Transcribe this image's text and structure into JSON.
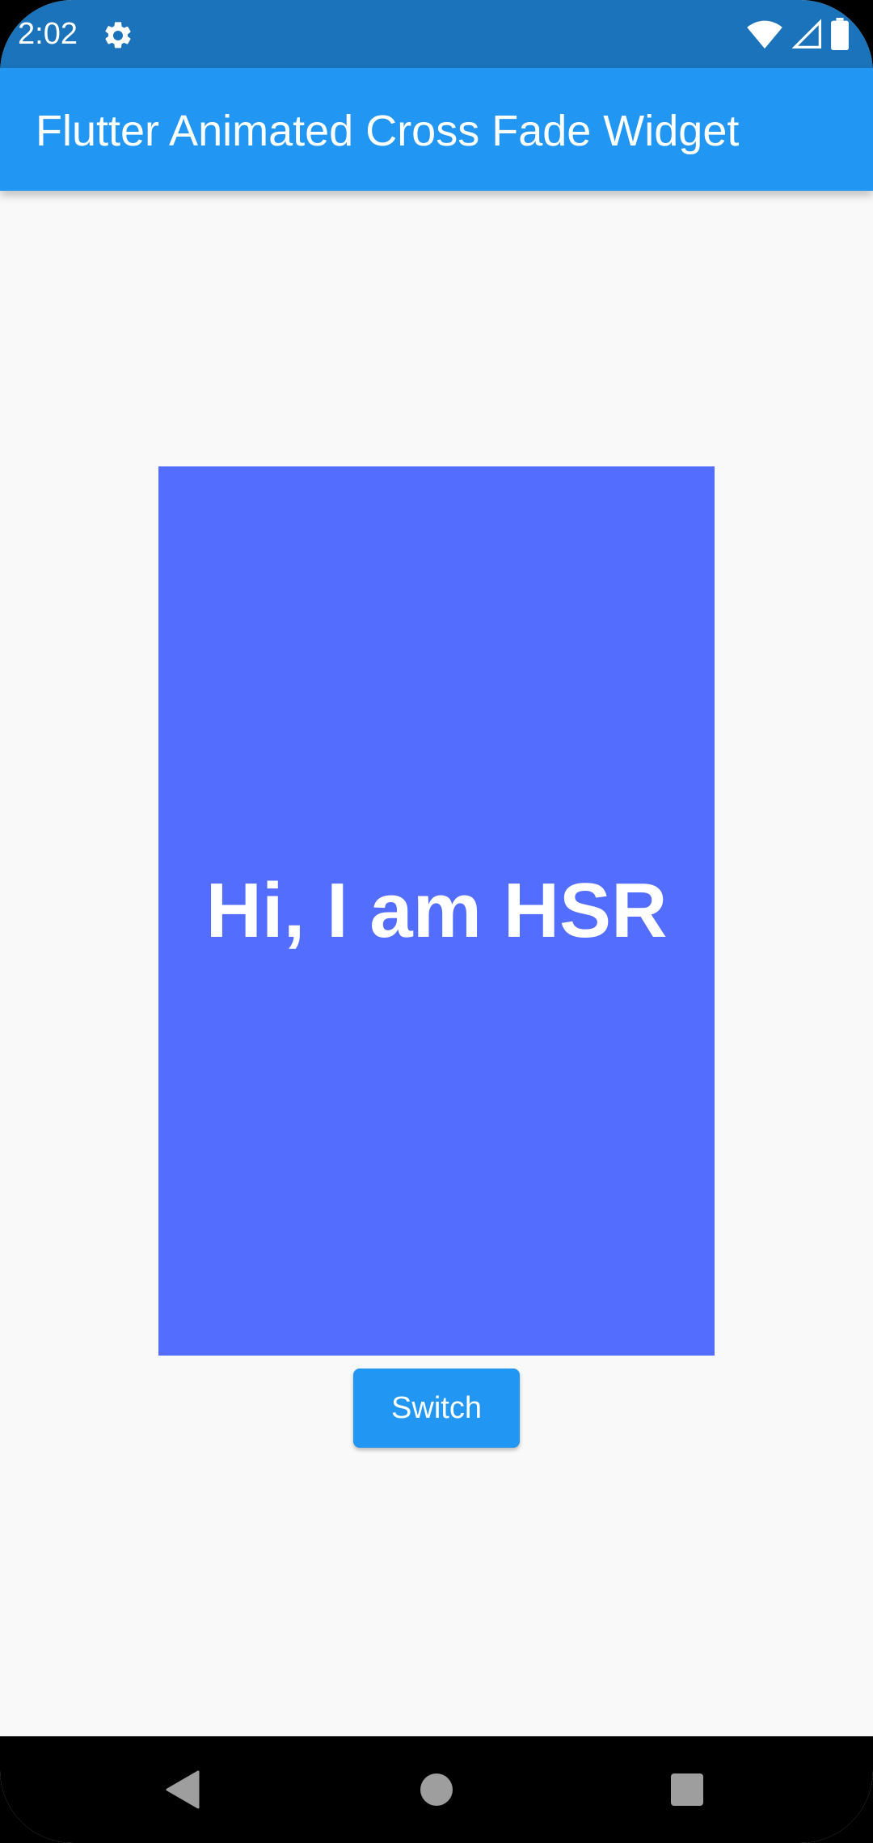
{
  "status_bar": {
    "time": "2:02",
    "icons": [
      "gear-icon",
      "wifi-icon",
      "signal-icon",
      "battery-icon"
    ],
    "color": "#1a73bb"
  },
  "app_bar": {
    "title": "Flutter Animated Cross Fade Widget",
    "color": "#2196f3"
  },
  "cross_fade": {
    "text": "Hi, I am HSR",
    "color": "#536dfe"
  },
  "switch_button": {
    "label": "Switch",
    "color": "#2196f3"
  },
  "nav_bar": {
    "buttons": [
      "back-icon",
      "home-icon",
      "recents-icon"
    ]
  }
}
